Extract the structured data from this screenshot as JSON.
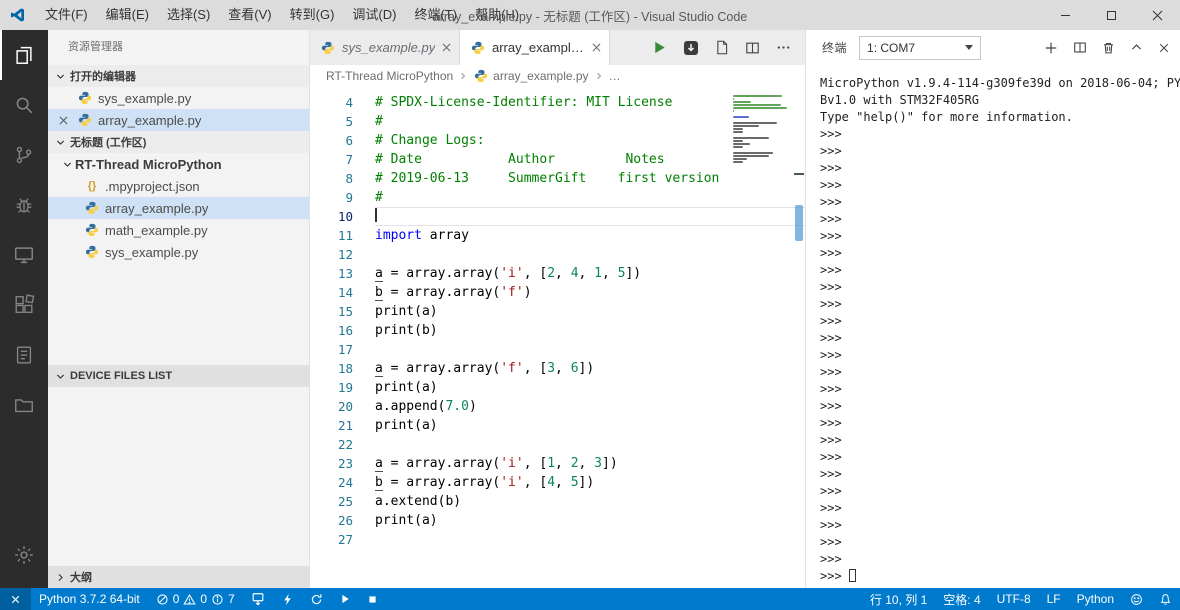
{
  "window": {
    "menus": [
      "文件(F)",
      "编辑(E)",
      "选择(S)",
      "查看(V)",
      "转到(G)",
      "调试(D)",
      "终端(T)",
      "帮助(H)"
    ],
    "title": "array_example.py - 无标题 (工作区) - Visual Studio Code"
  },
  "activity_bar": {
    "items": [
      {
        "name": "explorer",
        "icon": "files",
        "active": true
      },
      {
        "name": "search",
        "icon": "search",
        "active": false
      },
      {
        "name": "source-control",
        "icon": "git",
        "active": false
      },
      {
        "name": "debug",
        "icon": "debug",
        "active": false
      },
      {
        "name": "device-manager",
        "icon": "device",
        "active": false
      },
      {
        "name": "extensions",
        "icon": "extensions",
        "active": false
      },
      {
        "name": "notes",
        "icon": "notes",
        "active": false
      },
      {
        "name": "project-folders",
        "icon": "folder",
        "active": false
      }
    ]
  },
  "sidebar": {
    "title": "资源管理器",
    "sections": {
      "open_editors": {
        "label": "打开的编辑器"
      },
      "workspace": {
        "label": "无标题 (工作区)"
      },
      "device_files": {
        "label": "DEVICE FILES LIST"
      },
      "outline": {
        "label": "大纲"
      }
    },
    "open_editors": [
      {
        "label": "sys_example.py",
        "icon": "python",
        "selected": false,
        "close": false
      },
      {
        "label": "array_example.py",
        "icon": "python",
        "selected": true,
        "close": true
      }
    ],
    "workspace_folder": "RT-Thread MicroPython",
    "workspace_files": [
      {
        "label": ".mpyproject.json",
        "icon": "json",
        "selected": false
      },
      {
        "label": "array_example.py",
        "icon": "python",
        "selected": true
      },
      {
        "label": "math_example.py",
        "icon": "python",
        "selected": false
      },
      {
        "label": "sys_example.py",
        "icon": "python",
        "selected": false
      }
    ]
  },
  "editor": {
    "tabs": [
      {
        "label": "sys_example.py",
        "active": false,
        "preview": true
      },
      {
        "label": "array_example.py",
        "active": true,
        "preview": false
      }
    ],
    "actions": [
      {
        "name": "run-python-file-button",
        "icon": "run"
      },
      {
        "name": "download-to-device-button",
        "icon": "darkdl"
      },
      {
        "name": "open-preview-button",
        "icon": "page"
      },
      {
        "name": "split-editor-button",
        "icon": "split"
      },
      {
        "name": "more-actions-button",
        "icon": "more"
      }
    ],
    "breadcrumb": [
      {
        "label": "RT-Thread MicroPython"
      },
      {
        "label": "array_example.py",
        "icon": "python"
      },
      {
        "label": "…"
      }
    ],
    "current_line": 10,
    "lines": [
      {
        "n": 4,
        "tokens": [
          [
            "c",
            "# SPDX-License-Identifier: MIT License"
          ]
        ]
      },
      {
        "n": 5,
        "tokens": [
          [
            "c",
            "#"
          ]
        ]
      },
      {
        "n": 6,
        "tokens": [
          [
            "c",
            "# Change Logs:"
          ]
        ]
      },
      {
        "n": 7,
        "tokens": [
          [
            "c",
            "# Date           Author         Notes"
          ]
        ]
      },
      {
        "n": 8,
        "tokens": [
          [
            "c",
            "# 2019-06-13     SummerGift    first version"
          ]
        ]
      },
      {
        "n": 9,
        "tokens": [
          [
            "c",
            "#"
          ]
        ]
      },
      {
        "n": 10,
        "tokens": []
      },
      {
        "n": 11,
        "tokens": [
          [
            "k",
            "import"
          ],
          [
            "d",
            " array"
          ]
        ]
      },
      {
        "n": 12,
        "tokens": []
      },
      {
        "n": 13,
        "tokens": [
          [
            "u",
            "a"
          ],
          [
            "d",
            " = array.array("
          ],
          [
            "s",
            "'i'"
          ],
          [
            "d",
            ", ["
          ],
          [
            "n",
            "2"
          ],
          [
            "d",
            ", "
          ],
          [
            "n",
            "4"
          ],
          [
            "d",
            ", "
          ],
          [
            "n",
            "1"
          ],
          [
            "d",
            ", "
          ],
          [
            "n",
            "5"
          ],
          [
            "d",
            "])"
          ]
        ]
      },
      {
        "n": 14,
        "tokens": [
          [
            "u",
            "b"
          ],
          [
            "d",
            " = array.array("
          ],
          [
            "s",
            "'f'"
          ],
          [
            "d",
            ")"
          ]
        ]
      },
      {
        "n": 15,
        "tokens": [
          [
            "d",
            "print(a)"
          ]
        ]
      },
      {
        "n": 16,
        "tokens": [
          [
            "d",
            "print(b)"
          ]
        ]
      },
      {
        "n": 17,
        "tokens": []
      },
      {
        "n": 18,
        "tokens": [
          [
            "u",
            "a"
          ],
          [
            "d",
            " = array.array("
          ],
          [
            "s",
            "'f'"
          ],
          [
            "d",
            ", ["
          ],
          [
            "n",
            "3"
          ],
          [
            "d",
            ", "
          ],
          [
            "n",
            "6"
          ],
          [
            "d",
            "])"
          ]
        ]
      },
      {
        "n": 19,
        "tokens": [
          [
            "d",
            "print(a)"
          ]
        ]
      },
      {
        "n": 20,
        "tokens": [
          [
            "d",
            "a.append("
          ],
          [
            "n",
            "7.0"
          ],
          [
            "d",
            ")"
          ]
        ]
      },
      {
        "n": 21,
        "tokens": [
          [
            "d",
            "print(a)"
          ]
        ]
      },
      {
        "n": 22,
        "tokens": []
      },
      {
        "n": 23,
        "tokens": [
          [
            "u",
            "a"
          ],
          [
            "d",
            " = array.array("
          ],
          [
            "s",
            "'i'"
          ],
          [
            "d",
            ", ["
          ],
          [
            "n",
            "1"
          ],
          [
            "d",
            ", "
          ],
          [
            "n",
            "2"
          ],
          [
            "d",
            ", "
          ],
          [
            "n",
            "3"
          ],
          [
            "d",
            "])"
          ]
        ]
      },
      {
        "n": 24,
        "tokens": [
          [
            "u",
            "b"
          ],
          [
            "d",
            " = array.array("
          ],
          [
            "s",
            "'i'"
          ],
          [
            "d",
            ", ["
          ],
          [
            "n",
            "4"
          ],
          [
            "d",
            ", "
          ],
          [
            "n",
            "5"
          ],
          [
            "d",
            "])"
          ]
        ]
      },
      {
        "n": 25,
        "tokens": [
          [
            "d",
            "a.extend(b)"
          ]
        ]
      },
      {
        "n": 26,
        "tokens": [
          [
            "d",
            "print(a)"
          ]
        ]
      },
      {
        "n": 27,
        "tokens": []
      }
    ]
  },
  "panel": {
    "title": "终端",
    "terminal_select": "1: COM7",
    "actions": [
      {
        "name": "new-terminal-button",
        "icon": "plus"
      },
      {
        "name": "split-terminal-button",
        "icon": "splitpane"
      },
      {
        "name": "kill-terminal-button",
        "icon": "trash"
      },
      {
        "name": "maximize-panel-button",
        "icon": "chevup"
      },
      {
        "name": "close-panel-button",
        "icon": "close"
      }
    ],
    "output": [
      "MicroPython v1.9.4-114-g309fe39d on 2018-06-04; PY",
      "Bv1.0 with STM32F405RG",
      "Type \"help()\" for more information."
    ],
    "prompt": ">>> ",
    "prompt_count": 27
  },
  "status_bar": {
    "python_version": "Python 3.7.2 64-bit",
    "errors": "0",
    "warnings": "0",
    "infos": "7",
    "line_col": "行 10, 列 1",
    "spaces": "空格: 4",
    "encoding": "UTF-8",
    "eol": "LF",
    "language": "Python"
  },
  "colors": {
    "accent": "#007acc",
    "activity_bar": "#2c2c2c",
    "selection": "#cfe2f5",
    "comment": "#008000",
    "keyword": "#0000ff",
    "string": "#a31515",
    "number": "#098658"
  }
}
